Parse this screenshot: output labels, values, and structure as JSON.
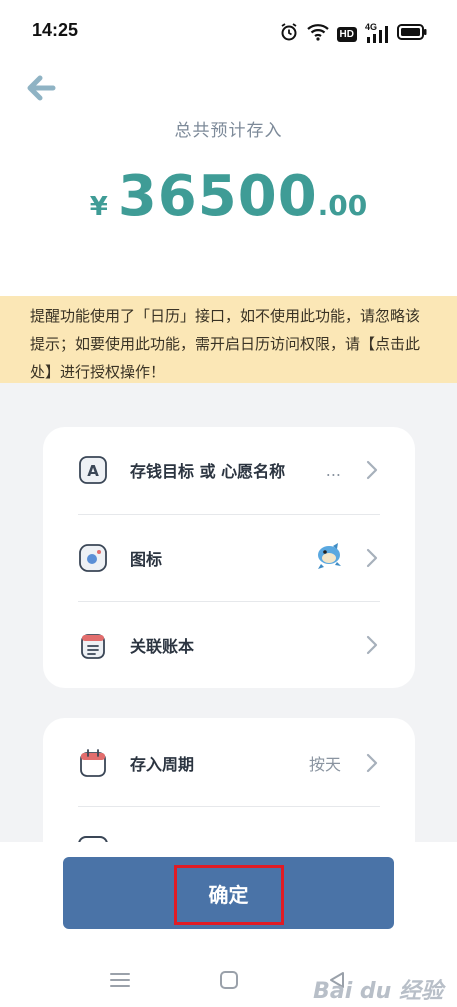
{
  "status": {
    "time": "14:25",
    "icons": [
      "alarm-icon",
      "wifi-icon",
      "hd-icon",
      "signal-4g-icon",
      "battery-icon"
    ],
    "hd_label": "HD",
    "net_label": "4G"
  },
  "header": {
    "back_icon": "arrow-left-icon",
    "total_label": "总共预计存入",
    "currency": "¥",
    "amount_int": "36500",
    "amount_dec": ".00",
    "accent_color": "#3f9c96"
  },
  "notice": {
    "text": "提醒功能使用了「日历」接口，如不使用此功能，请忽略该提示；如要使用此功能，需开启日历访问权限，请【点击此处】进行授权操作！"
  },
  "card1": {
    "rows": [
      {
        "icon": "letter-a-icon",
        "label": "存钱目标 或 心愿名称",
        "value": "..."
      },
      {
        "icon": "record-icon",
        "label": "图标",
        "value": "",
        "value_icon": "dolphin-icon"
      },
      {
        "icon": "calendar-list-icon",
        "label": "关联账本",
        "value": ""
      }
    ]
  },
  "card2": {
    "rows": [
      {
        "icon": "calendar-icon",
        "label": "存入周期",
        "value": "按天"
      }
    ]
  },
  "footer": {
    "confirm_label": "确定",
    "button_color": "#4a73a7",
    "watermark": "Bai du 经验"
  },
  "nav": {
    "icons": [
      "menu-icon",
      "home-square-icon",
      "back-triangle-icon"
    ]
  }
}
